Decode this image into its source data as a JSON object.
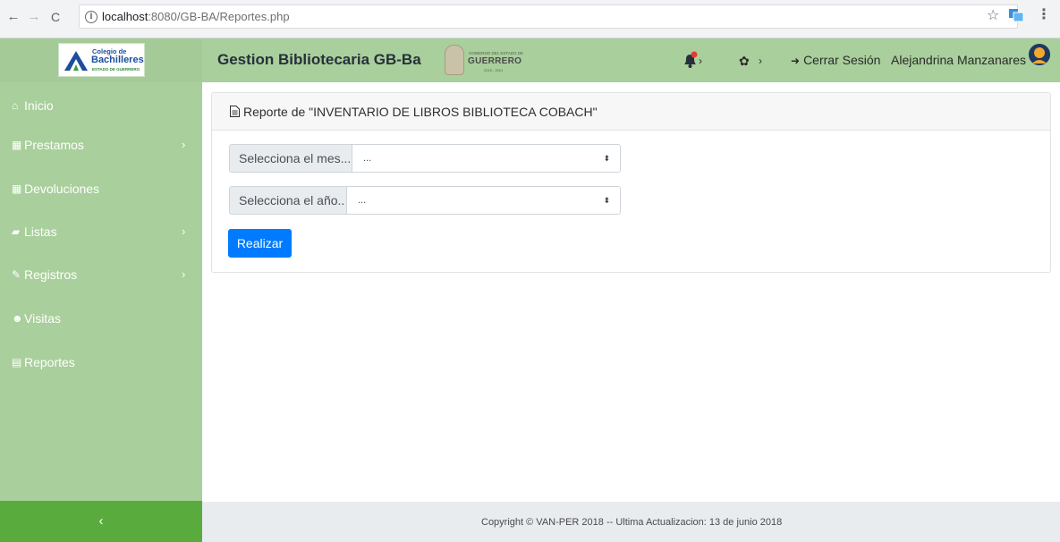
{
  "browser": {
    "url_host": "localhost",
    "url_rest": ":8080/GB-BA/Reportes.php",
    "back_icon": "←",
    "forward_icon": "→",
    "reload_icon": "C",
    "info_icon": "i",
    "star_icon": "☆",
    "menu_icon": "⋮"
  },
  "header": {
    "logo_line1": "Colegio de",
    "logo_line2": "Bachilleres",
    "logo_line3": "ESTADO DE GUERRERO",
    "app_title": "Gestion Bibliotecaria GB-Ba",
    "gov_small": "GOBIERNO DEL ESTADO DE",
    "gov_name": "GUERRERO",
    "gov_years": "2015 - 2021",
    "bell_chevron": "›",
    "gear_icon": "✿",
    "gear_chevron": "›",
    "logout_icon": "➜",
    "logout_label": "Cerrar Sesión",
    "username": "Alejandrina Manzanares"
  },
  "sidebar": {
    "items": [
      {
        "icon": "⌂",
        "label": "Inicio",
        "chevron": ""
      },
      {
        "icon": "▦",
        "label": "Prestamos",
        "chevron": "›"
      },
      {
        "icon": "▦",
        "label": "Devoluciones",
        "chevron": ""
      },
      {
        "icon": "▰",
        "label": "Listas",
        "chevron": "›"
      },
      {
        "icon": "✎",
        "label": "Registros",
        "chevron": "›"
      },
      {
        "icon": "☻",
        "label": "Visitas",
        "chevron": ""
      },
      {
        "icon": "▤",
        "label": "Reportes",
        "chevron": ""
      }
    ],
    "toggle_icon": "‹"
  },
  "main": {
    "card_title": "Reporte de \"INVENTARIO DE LIBROS BIBLIOTECA COBACH\"",
    "month_label": "Selecciona el mes...",
    "month_value": "...",
    "year_label": "Selecciona el año..",
    "year_value": "...",
    "caret": "⬍",
    "submit_label": "Realizar"
  },
  "footer": {
    "text": "Copyright © VAN-PER 2018 -- Ultima Actualizacion: 13 de junio 2018"
  },
  "colors": {
    "sidebar_bg": "#a9cf9c",
    "toggle_bg": "#5aab3e",
    "primary": "#007bff",
    "notification_dot": "#e53935"
  }
}
